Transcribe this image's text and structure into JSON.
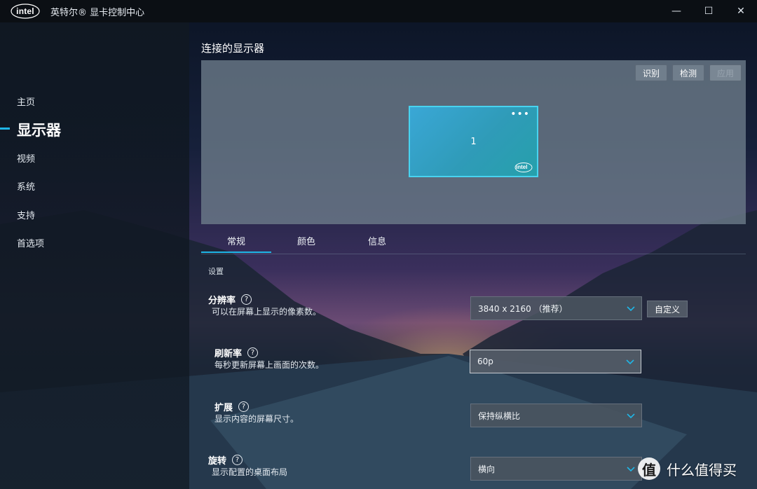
{
  "app": {
    "logo_text": "intel",
    "title": "英特尔® 显卡控制中心",
    "window_controls": {
      "minimize": "—",
      "maximize": "☐",
      "close": "✕"
    }
  },
  "sidebar": {
    "items": [
      {
        "label": "主页",
        "active": false
      },
      {
        "label": "显示器",
        "active": true
      },
      {
        "label": "视频",
        "active": false
      },
      {
        "label": "系统",
        "active": false
      },
      {
        "label": "支持",
        "active": false
      },
      {
        "label": "首选项",
        "active": false
      }
    ]
  },
  "main": {
    "title": "连接的显示器",
    "panel_buttons": {
      "identify": "识别",
      "detect": "检测",
      "apply": "应用"
    },
    "monitor": {
      "number": "1",
      "menu": "•••",
      "brand": "intel"
    },
    "tabs": [
      {
        "label": "常规",
        "active": true
      },
      {
        "label": "颜色",
        "active": false
      },
      {
        "label": "信息",
        "active": false
      }
    ],
    "section_label": "设置",
    "settings": {
      "resolution": {
        "title": "分辨率",
        "help": "?",
        "desc": "可以在屏幕上显示的像素数。",
        "value": "3840 x 2160 （推荐）",
        "custom_label": "自定义"
      },
      "refresh": {
        "title": "刷新率",
        "help": "?",
        "desc": "每秒更新屏幕上画面的次数。",
        "value": "60p"
      },
      "scaling": {
        "title": "扩展",
        "help": "?",
        "desc": "显示内容的屏幕尺寸。",
        "value": "保持纵横比"
      },
      "rotation": {
        "title": "旋转",
        "help": "?",
        "desc": "显示配置的桌面布局",
        "value": "横向"
      }
    }
  },
  "watermark": {
    "icon": "值",
    "text": "什么值得买"
  },
  "colors": {
    "accent": "#1fb6e6",
    "monitor_border": "#48d3ef"
  }
}
